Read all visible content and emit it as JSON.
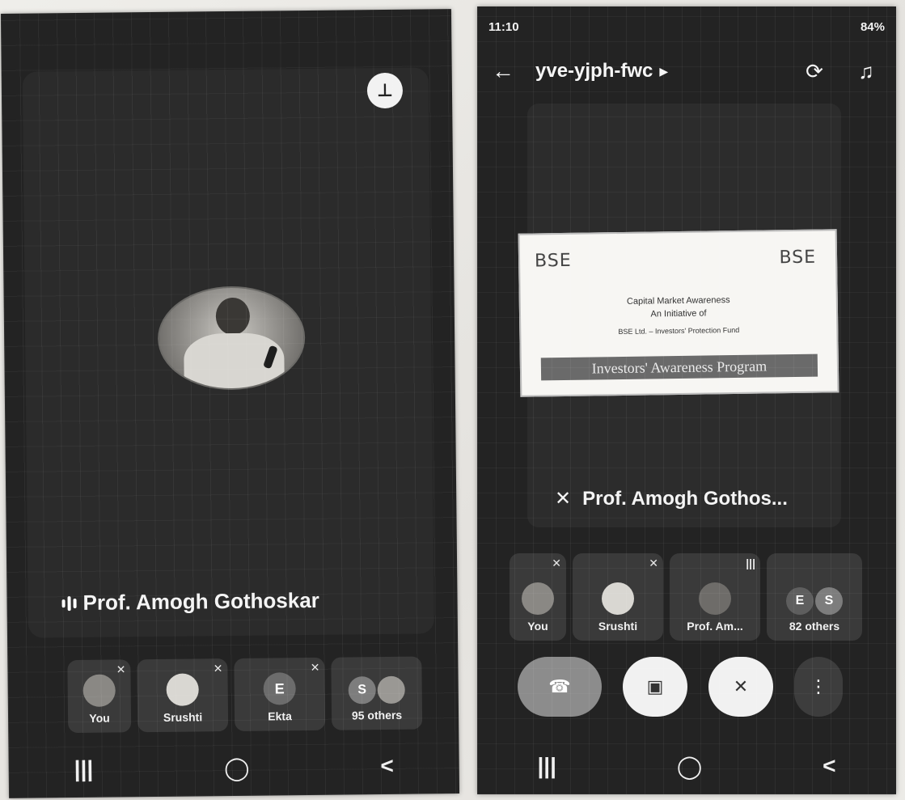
{
  "left_screen": {
    "pin_icon": "pin-icon",
    "speaker": {
      "name": "Prof. Amogh Gothoskar",
      "icon": "speaking-audio-icon"
    },
    "participants": [
      {
        "label": "You",
        "avatar_initial": "",
        "avatar_color": "#8a8884",
        "muted": true
      },
      {
        "label": "Srushti",
        "avatar_initial": "",
        "avatar_color": "#d9d7d2",
        "muted": true
      },
      {
        "label": "Ekta",
        "avatar_initial": "E",
        "avatar_color": "#6c6c6c",
        "muted": true
      },
      {
        "label": "95 others",
        "avatar_initial": "S",
        "avatar_color": "#7d7d7d",
        "muted": false
      }
    ],
    "nav": {
      "recent": "|||",
      "home": "◯",
      "back": "<"
    }
  },
  "right_screen": {
    "status_bar": {
      "time": "11:10",
      "battery": "84%"
    },
    "top_bar": {
      "meeting_code": "yve-yjph-fwc",
      "back_icon": "arrow-left-icon",
      "switch_camera_icon": "switch-camera-icon",
      "audio_icon": "headphones-icon"
    },
    "slide": {
      "logo_left": "BSE",
      "logo_right": "BSE",
      "line1": "Capital Market Awareness",
      "line2": "An Initiative of",
      "line3": "BSE Ltd. – Investors' Protection Fund",
      "banner": "Investors' Awareness Program"
    },
    "speaker": {
      "name": "Prof. Amogh Gothos...",
      "icon": "mic-off-icon"
    },
    "participants": [
      {
        "label": "You",
        "avatar_initial": "",
        "avatar_color": "#8a8884",
        "muted": true
      },
      {
        "label": "Srushti",
        "avatar_initial": "",
        "avatar_color": "#d9d7d2",
        "muted": true
      },
      {
        "label": "Prof. Am...",
        "avatar_initial": "",
        "avatar_color": "#6e6c69",
        "muted": false
      },
      {
        "label": "82 others",
        "avatar_initial": "S",
        "avatar_color": "#7d7d7d",
        "muted": false
      }
    ],
    "controls": {
      "end_call_icon": "end-call-icon",
      "camera_icon": "camera-off-icon",
      "mic_icon": "mic-off-icon",
      "more_icon": "more-vertical-icon"
    },
    "nav": {
      "recent": "|||",
      "home": "◯",
      "back": "<"
    }
  }
}
